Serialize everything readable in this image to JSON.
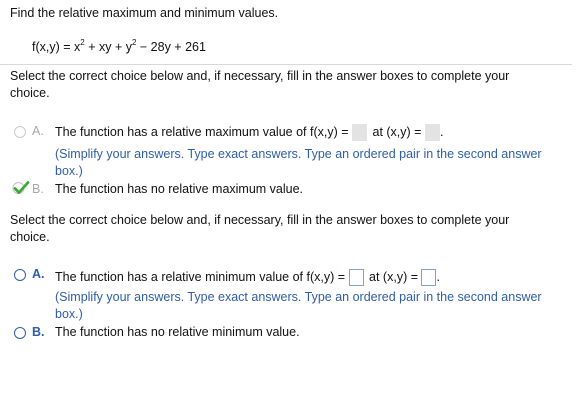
{
  "question": {
    "instruction": "Find the relative maximum and minimum values.",
    "function": {
      "lhs": "f(x,y) = x",
      "exp1": "2",
      "mid": " + xy + y",
      "exp2": "2",
      "rhs": " − 28y + 261"
    }
  },
  "part1": {
    "prompt": "Select the correct choice below and, if necessary, fill in the answer boxes to complete your choice.",
    "choice_a": {
      "letter": "A.",
      "text_before": "The function has a relative maximum value of f(x,y) =",
      "text_mid": "at (x,y) =",
      "text_after": ".",
      "hint": "(Simplify your answers. Type exact answers. Type an ordered pair in the second answer box.)"
    },
    "choice_b": {
      "letter": "B.",
      "text": "The function has no relative maximum value.",
      "selected": true
    }
  },
  "part2": {
    "prompt": "Select the correct choice below and, if necessary, fill in the answer boxes to complete your choice.",
    "choice_a": {
      "letter": "A.",
      "text_before": "The function has a relative minimum value of f(x,y) =",
      "text_mid": "at (x,y) =",
      "text_after": ".",
      "hint": "(Simplify your answers. Type exact answers. Type an ordered pair in the second answer box.)"
    },
    "choice_b": {
      "letter": "B.",
      "text": "The function has no relative minimum value."
    }
  },
  "colors": {
    "accent": "#2f5ea8",
    "check": "#3fa63a",
    "disabled": "#a8a8a8"
  }
}
